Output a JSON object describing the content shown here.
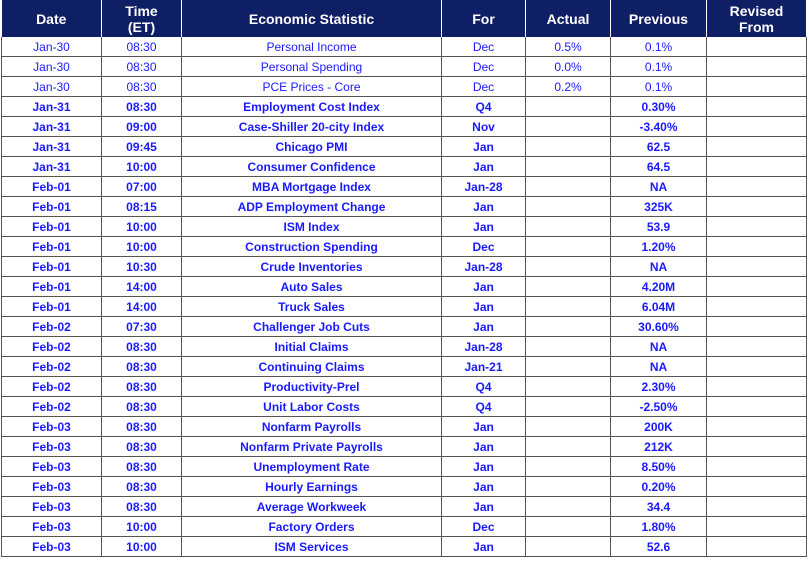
{
  "colors": {
    "header_bg": "#0f1f66",
    "text": "#1a1aff"
  },
  "headers": {
    "date": "Date",
    "time_1": "Time",
    "time_2": "(ET)",
    "stat": "Economic Statistic",
    "for": "For",
    "actual": "Actual",
    "previous": "Previous",
    "revised_1": "Revised",
    "revised_2": "From"
  },
  "rows": [
    {
      "date": "Jan-30",
      "time": "08:30",
      "stat": "Personal Income",
      "for": "Dec",
      "actual": "0.5%",
      "previous": "0.1%",
      "revised": "",
      "bold": false
    },
    {
      "date": "Jan-30",
      "time": "08:30",
      "stat": "Personal Spending",
      "for": "Dec",
      "actual": "0.0%",
      "previous": "0.1%",
      "revised": "",
      "bold": false
    },
    {
      "date": "Jan-30",
      "time": "08:30",
      "stat": "PCE Prices - Core",
      "for": "Dec",
      "actual": "0.2%",
      "previous": "0.1%",
      "revised": "",
      "bold": false
    },
    {
      "date": "Jan-31",
      "time": "08:30",
      "stat": "Employment Cost Index",
      "for": "Q4",
      "actual": "",
      "previous": "0.30%",
      "revised": "",
      "bold": true
    },
    {
      "date": "Jan-31",
      "time": "09:00",
      "stat": "Case-Shiller 20-city Index",
      "for": "Nov",
      "actual": "",
      "previous": "-3.40%",
      "revised": "",
      "bold": true
    },
    {
      "date": "Jan-31",
      "time": "09:45",
      "stat": "Chicago PMI",
      "for": "Jan",
      "actual": "",
      "previous": "62.5",
      "revised": "",
      "bold": true
    },
    {
      "date": "Jan-31",
      "time": "10:00",
      "stat": "Consumer Confidence",
      "for": "Jan",
      "actual": "",
      "previous": "64.5",
      "revised": "",
      "bold": true
    },
    {
      "date": "Feb-01",
      "time": "07:00",
      "stat": "MBA Mortgage Index",
      "for": "Jan-28",
      "actual": "",
      "previous": "NA",
      "revised": "",
      "bold": true
    },
    {
      "date": "Feb-01",
      "time": "08:15",
      "stat": "ADP Employment Change",
      "for": "Jan",
      "actual": "",
      "previous": "325K",
      "revised": "",
      "bold": true
    },
    {
      "date": "Feb-01",
      "time": "10:00",
      "stat": "ISM Index",
      "for": "Jan",
      "actual": "",
      "previous": "53.9",
      "revised": "",
      "bold": true
    },
    {
      "date": "Feb-01",
      "time": "10:00",
      "stat": "Construction Spending",
      "for": "Dec",
      "actual": "",
      "previous": "1.20%",
      "revised": "",
      "bold": true
    },
    {
      "date": "Feb-01",
      "time": "10:30",
      "stat": "Crude Inventories",
      "for": "Jan-28",
      "actual": "",
      "previous": "NA",
      "revised": "",
      "bold": true
    },
    {
      "date": "Feb-01",
      "time": "14:00",
      "stat": "Auto Sales",
      "for": "Jan",
      "actual": "",
      "previous": "4.20M",
      "revised": "",
      "bold": true
    },
    {
      "date": "Feb-01",
      "time": "14:00",
      "stat": "Truck Sales",
      "for": "Jan",
      "actual": "",
      "previous": "6.04M",
      "revised": "",
      "bold": true
    },
    {
      "date": "Feb-02",
      "time": "07:30",
      "stat": "Challenger Job Cuts",
      "for": "Jan",
      "actual": "",
      "previous": "30.60%",
      "revised": "",
      "bold": true
    },
    {
      "date": "Feb-02",
      "time": "08:30",
      "stat": "Initial Claims",
      "for": "Jan-28",
      "actual": "",
      "previous": "NA",
      "revised": "",
      "bold": true
    },
    {
      "date": "Feb-02",
      "time": "08:30",
      "stat": "Continuing Claims",
      "for": "Jan-21",
      "actual": "",
      "previous": "NA",
      "revised": "",
      "bold": true
    },
    {
      "date": "Feb-02",
      "time": "08:30",
      "stat": "Productivity-Prel",
      "for": "Q4",
      "actual": "",
      "previous": "2.30%",
      "revised": "",
      "bold": true
    },
    {
      "date": "Feb-02",
      "time": "08:30",
      "stat": "Unit Labor Costs",
      "for": "Q4",
      "actual": "",
      "previous": "-2.50%",
      "revised": "",
      "bold": true
    },
    {
      "date": "Feb-03",
      "time": "08:30",
      "stat": "Nonfarm Payrolls",
      "for": "Jan",
      "actual": "",
      "previous": "200K",
      "revised": "",
      "bold": true
    },
    {
      "date": "Feb-03",
      "time": "08:30",
      "stat": "Nonfarm Private Payrolls",
      "for": "Jan",
      "actual": "",
      "previous": "212K",
      "revised": "",
      "bold": true
    },
    {
      "date": "Feb-03",
      "time": "08:30",
      "stat": "Unemployment Rate",
      "for": "Jan",
      "actual": "",
      "previous": "8.50%",
      "revised": "",
      "bold": true
    },
    {
      "date": "Feb-03",
      "time": "08:30",
      "stat": "Hourly Earnings",
      "for": "Jan",
      "actual": "",
      "previous": "0.20%",
      "revised": "",
      "bold": true
    },
    {
      "date": "Feb-03",
      "time": "08:30",
      "stat": "Average Workweek",
      "for": "Jan",
      "actual": "",
      "previous": "34.4",
      "revised": "",
      "bold": true
    },
    {
      "date": "Feb-03",
      "time": "10:00",
      "stat": "Factory Orders",
      "for": "Dec",
      "actual": "",
      "previous": "1.80%",
      "revised": "",
      "bold": true
    },
    {
      "date": "Feb-03",
      "time": "10:00",
      "stat": "ISM Services",
      "for": "Jan",
      "actual": "",
      "previous": "52.6",
      "revised": "",
      "bold": true
    }
  ]
}
